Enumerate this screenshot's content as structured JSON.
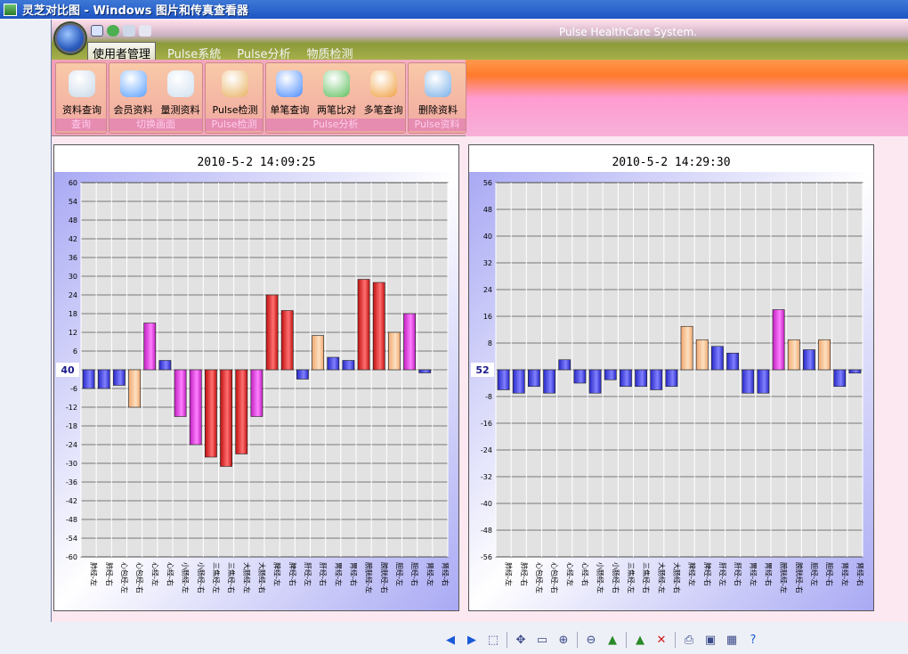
{
  "window": {
    "title": "灵芝对比图 - Windows 图片和传真查看器"
  },
  "ribbon": {
    "system_label": "Pulse HealthCare System.",
    "tabs": [
      "使用者管理",
      "Pulse系統",
      "Pulse分析",
      "物质检测"
    ],
    "active_tab": 0,
    "groups": [
      {
        "label": "查询",
        "buttons": [
          {
            "label": "资料查询",
            "icon": "magnifier-doc-icon"
          }
        ]
      },
      {
        "label": "切换画面",
        "buttons": [
          {
            "label": "会员资料",
            "icon": "user-card-icon"
          },
          {
            "label": "量测资料",
            "icon": "measure-doc-icon"
          }
        ]
      },
      {
        "label": "Pulse检测",
        "buttons": [
          {
            "label": "Pulse检测",
            "icon": "doctor-icon"
          }
        ]
      },
      {
        "label": "Pulse分析",
        "buttons": [
          {
            "label": "单笔查询",
            "icon": "single-user-icon"
          },
          {
            "label": "两笔比对",
            "icon": "two-users-icon"
          },
          {
            "label": "多笔查询",
            "icon": "multi-users-icon"
          }
        ]
      },
      {
        "label": "Pulse资料",
        "buttons": [
          {
            "label": "删除资料",
            "icon": "delete-folder-icon"
          }
        ]
      }
    ]
  },
  "colors": {
    "low": "#3a3ae0",
    "mild": "#f8c896",
    "mid": "#e040e0",
    "high": "#e02020"
  },
  "chart_data": [
    {
      "type": "bar",
      "title": "2010-5-2 14:09:25",
      "baseline_label": "40",
      "ylim": [
        -60,
        60
      ],
      "yticks": [
        60,
        54,
        48,
        42,
        36,
        30,
        24,
        18,
        12,
        6,
        0,
        -6,
        -12,
        -18,
        -24,
        -30,
        -36,
        -42,
        -48,
        -54,
        -60
      ],
      "categories": [
        "肺经-左",
        "肺经-右",
        "心包经-左",
        "心包经-右",
        "心经-左",
        "心经-右",
        "小肠经-左",
        "小肠经-右",
        "三焦经-左",
        "三焦经-右",
        "大肠经-左",
        "大肠经-右",
        "脾经-左",
        "脾经-右",
        "肝经-左",
        "肝经-右",
        "胃经-左",
        "胃经-右",
        "膀胱经-左",
        "膀胱经-右",
        "胆经-左",
        "胆经-右",
        "肾经-左",
        "肾经-右"
      ],
      "values": [
        -6,
        -6,
        -5,
        -12,
        15,
        3,
        -15,
        -24,
        -28,
        -31,
        -27,
        -15,
        24,
        19,
        -3,
        11,
        4,
        3,
        29,
        28,
        12,
        18,
        -1,
        0
      ],
      "colors": [
        "low",
        "low",
        "low",
        "mild",
        "mid",
        "low",
        "mid",
        "mid",
        "high",
        "high",
        "high",
        "mid",
        "high",
        "high",
        "low",
        "mild",
        "low",
        "low",
        "high",
        "high",
        "mild",
        "mid",
        "low",
        "low"
      ]
    },
    {
      "type": "bar",
      "title": "2010-5-2 14:29:30",
      "baseline_label": "52",
      "ylim": [
        -56,
        56
      ],
      "yticks": [
        56,
        48,
        40,
        32,
        24,
        16,
        8,
        0,
        -8,
        -16,
        -24,
        -32,
        -40,
        -48,
        -56
      ],
      "categories": [
        "肺经-左",
        "肺经-右",
        "心包经-左",
        "心包经-右",
        "心经-左",
        "心经-右",
        "小肠经-左",
        "小肠经-右",
        "三焦经-左",
        "三焦经-右",
        "大肠经-左",
        "大肠经-右",
        "脾经-左",
        "脾经-右",
        "肝经-左",
        "肝经-右",
        "胃经-左",
        "胃经-右",
        "膀胱经-左",
        "膀胱经-右",
        "胆经-左",
        "胆经-右",
        "肾经-左",
        "肾经-右"
      ],
      "values": [
        -6,
        -7,
        -5,
        -7,
        3,
        -4,
        -7,
        -3,
        -5,
        -5,
        -6,
        -5,
        13,
        9,
        7,
        5,
        -7,
        -7,
        18,
        9,
        6,
        9,
        -5,
        -1
      ],
      "colors": [
        "low",
        "low",
        "low",
        "low",
        "low",
        "low",
        "low",
        "low",
        "low",
        "low",
        "low",
        "low",
        "mild",
        "mild",
        "low",
        "low",
        "low",
        "low",
        "mid",
        "mild",
        "low",
        "mild",
        "low",
        "low"
      ]
    }
  ],
  "viewer_toolbar": [
    "prev-icon",
    "next-icon",
    "best-fit-icon",
    "actual-size-icon",
    "slideshow-icon",
    "zoom-in-icon",
    "zoom-out-icon",
    "rotate-cw-icon",
    "rotate-ccw-icon",
    "delete-icon",
    "print-icon",
    "save-icon",
    "open-editor-icon",
    "help-icon"
  ]
}
